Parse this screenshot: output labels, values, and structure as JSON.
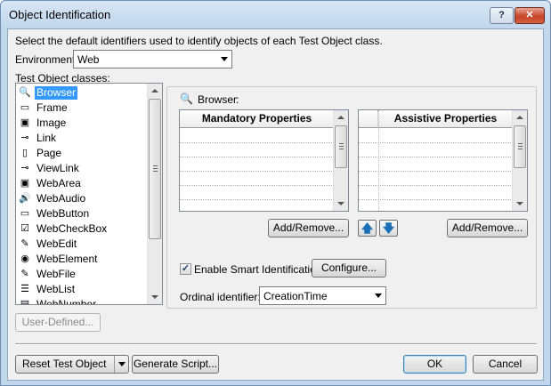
{
  "window": {
    "title": "Object Identification",
    "help_label": "?",
    "close_label": "✕"
  },
  "intro": "Select the default identifiers used to identify objects of each Test Object class.",
  "environment": {
    "label": "Environment:",
    "value": "Web"
  },
  "classes_label": "Test Object classes:",
  "classes": [
    {
      "label": "Browser",
      "icon": "browser-icon",
      "glyph": "🔍",
      "selected": true
    },
    {
      "label": "Frame",
      "icon": "frame-icon",
      "glyph": "▭"
    },
    {
      "label": "Image",
      "icon": "image-icon",
      "glyph": "▣"
    },
    {
      "label": "Link",
      "icon": "link-icon",
      "glyph": "⊸"
    },
    {
      "label": "Page",
      "icon": "page-icon",
      "glyph": "▯"
    },
    {
      "label": "ViewLink",
      "icon": "viewlink-icon",
      "glyph": "⊸"
    },
    {
      "label": "WebArea",
      "icon": "webarea-icon",
      "glyph": "▣"
    },
    {
      "label": "WebAudio",
      "icon": "webaudio-icon",
      "glyph": "🔊"
    },
    {
      "label": "WebButton",
      "icon": "webbutton-icon",
      "glyph": "▭"
    },
    {
      "label": "WebCheckBox",
      "icon": "webcheckbox-icon",
      "glyph": "☑"
    },
    {
      "label": "WebEdit",
      "icon": "webedit-icon",
      "glyph": "✎"
    },
    {
      "label": "WebElement",
      "icon": "webelement-icon",
      "glyph": "◉"
    },
    {
      "label": "WebFile",
      "icon": "webfile-icon",
      "glyph": "✎"
    },
    {
      "label": "WebList",
      "icon": "weblist-icon",
      "glyph": "☰"
    },
    {
      "label": "WebNumber",
      "icon": "webnumber-icon",
      "glyph": "▤"
    }
  ],
  "user_defined_label": "User-Defined...",
  "panel": {
    "selected_class": "Browser",
    "mandatory_header": "Mandatory Properties",
    "assistive_header": "Assistive Properties",
    "add_remove_left": "Add/Remove...",
    "add_remove_right": "Add/Remove...",
    "move_up": "🡅",
    "move_down": "🡇",
    "smart_id_label": "Enable Smart Identification:",
    "smart_id_checked": true,
    "configure_label": "Configure...",
    "ordinal_label": "Ordinal identifier:",
    "ordinal_value": "CreationTime"
  },
  "footer": {
    "reset_label": "Reset Test Object",
    "generate_label": "Generate Script...",
    "ok_label": "OK",
    "cancel_label": "Cancel"
  },
  "colors": {
    "selection": "#3399ff",
    "titlebar": "#c2d7ec",
    "close": "#c5442a"
  }
}
